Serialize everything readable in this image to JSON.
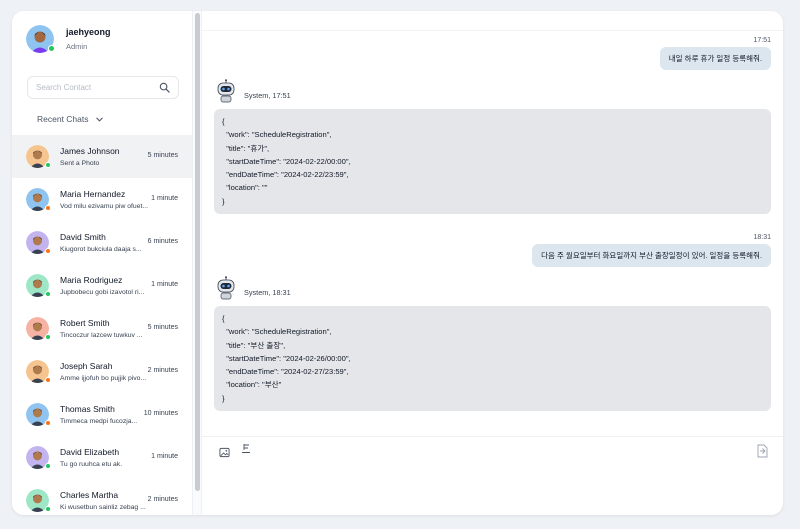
{
  "profile": {
    "name": "jaehyeong",
    "role": "Admin",
    "status_color": "#22c55e"
  },
  "search": {
    "placeholder": "Search Contact",
    "icon": "search-icon"
  },
  "recent": {
    "label": "Recent Chats",
    "icon": "chevron-down-icon"
  },
  "contacts": [
    {
      "name": "James Johnson",
      "message": "Sent a Photo",
      "time": "5 minutes",
      "avatar_bg": "#f6c58f",
      "status_color": "#22c55e",
      "active": true
    },
    {
      "name": "Maria Hernandez",
      "message": "Vod milu ezivamu piw ofuet...",
      "time": "1 minute",
      "avatar_bg": "#8fc4f0",
      "status_color": "#f97316"
    },
    {
      "name": "David Smith",
      "message": "Kiugorot bukciula daaja s...",
      "time": "6 minutes",
      "avatar_bg": "#c3b4ef",
      "status_color": "#f97316"
    },
    {
      "name": "Maria Rodriguez",
      "message": "Jupbobecu gobi izavotol ri...",
      "time": "1 minute",
      "avatar_bg": "#9ee7c6",
      "status_color": "#22c55e"
    },
    {
      "name": "Robert Smith",
      "message": "Tincoczur lazcew tuwkuv ...",
      "time": "5 minutes",
      "avatar_bg": "#f6b2a3",
      "status_color": "#22c55e"
    },
    {
      "name": "Joseph Sarah",
      "message": "Amme ijjofuh bo pujjik pivo...",
      "time": "2 minutes",
      "avatar_bg": "#f6c58f",
      "status_color": "#f97316"
    },
    {
      "name": "Thomas Smith",
      "message": "Timmeca medpi fucozja...",
      "time": "10 minutes",
      "avatar_bg": "#8fc4f0",
      "status_color": "#f97316"
    },
    {
      "name": "David Elizabeth",
      "message": "Tu go ruuhca etu ak.",
      "time": "1 minute",
      "avatar_bg": "#c3b4ef",
      "status_color": "#22c55e"
    },
    {
      "name": "Charles Martha",
      "message": "Ki wusetbun sainliz zebag ...",
      "time": "2 minutes",
      "avatar_bg": "#9ee7c6",
      "status_color": "#22c55e"
    }
  ],
  "messages": [
    {
      "type": "user",
      "time": "17:51",
      "text": "내일 하루 휴가 일정 등록해줘."
    },
    {
      "type": "system",
      "label": "System, 17:51",
      "lines": [
        "{",
        "  \"work\": \"ScheduleRegistration\",",
        "  \"title\": \"휴가\",",
        "  \"startDateTime\": \"2024-02-22/00:00\",",
        "  \"endDateTime\": \"2024-02-22/23:59\",",
        "  \"location\": \"\"",
        "}"
      ]
    },
    {
      "type": "user",
      "time": "18:31",
      "text": "다음 주 월요일부터 화요일까지 부산 출장일정이 있어. 일정을 등록해줘."
    },
    {
      "type": "system",
      "label": "System, 18:31",
      "lines": [
        "{",
        "  \"work\": \"ScheduleRegistration\",",
        "  \"title\": \"부산 출장\",",
        "  \"startDateTime\": \"2024-02-26/00:00\",",
        "  \"endDateTime\": \"2024-02-27/23:59\",",
        "  \"location\": \"부산\"",
        "}"
      ]
    }
  ],
  "composer": {
    "icons": [
      "image-icon",
      "emoji-icon",
      "send-icon"
    ]
  },
  "colors": {
    "user_bubble": "#dce6ef",
    "system_bubble": "#e4e6ea",
    "active_contact": "#f1f2f4"
  }
}
